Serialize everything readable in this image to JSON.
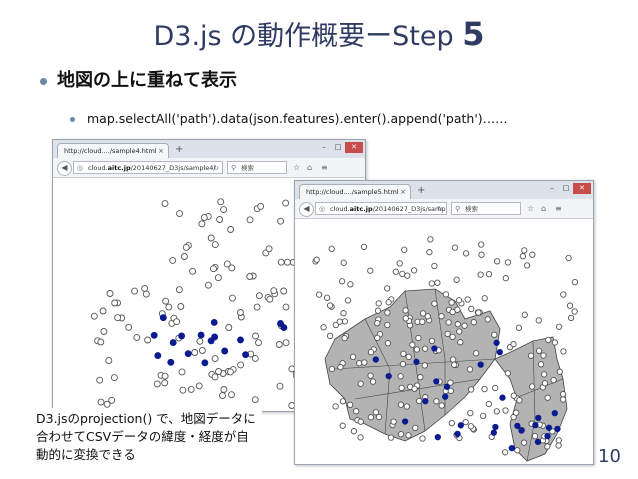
{
  "slide": {
    "title_main": "D3.js の動作概要ーStep",
    "title_num": "5",
    "bullet1": "地図の上に重ねて表示",
    "bullet2": "map.selectAll('path').data(json.features).enter().append('path')……",
    "caption": "D3.jsのprojection() で、地図データに\n合わせてCSVデータの緯度・経度が自\n動的に変換できる",
    "page_number": "10"
  },
  "window1": {
    "tab_title": "http://cloud..../sample4.html",
    "url_prefix": "cloud.",
    "url_bold": "aitc.jp",
    "url_rest": "/20140627_D3js/sample4/",
    "search_placeholder": "検索"
  },
  "window2": {
    "tab_title": "http://cloud..../sample5.html",
    "url_prefix": "cloud.",
    "url_bold": "aitc.jp",
    "url_rest": "/20140627_D3js/sample5/",
    "search_placeholder": "検索"
  },
  "colors": {
    "title": "#2f3b63",
    "bullet_dot": "#6d87a6",
    "point_outline": "#555555",
    "point_highlight": "#0a1b8f",
    "map_fill": "#b3b3b3",
    "map_stroke": "#444444"
  },
  "icons": {
    "new_tab": "+",
    "tab_close": "×",
    "globe": "◎",
    "reload": "↻",
    "search": "⚲",
    "back": "◀",
    "star": "☆",
    "home": "⌂",
    "menu": "≡",
    "minimize": "–",
    "maximize": "□",
    "close": "✕"
  }
}
